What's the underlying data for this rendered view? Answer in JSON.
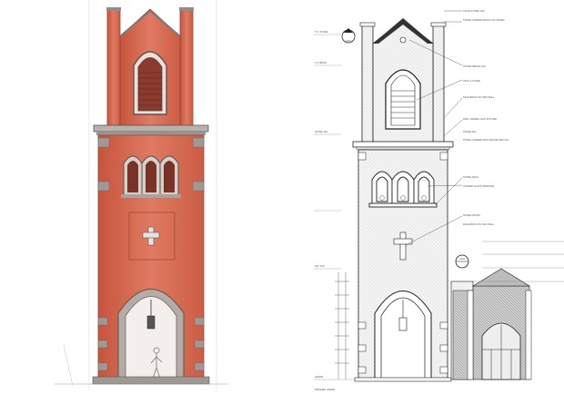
{
  "figure": {
    "left_panel": "watercolor rendering of brick church bell tower (front elevation)",
    "right_panel": "line-drawing architectural elevation with dimension markers and notes"
  },
  "colors": {
    "brick": "#d9705a",
    "brick_dark": "#c2543f",
    "trim": "#6b6b6b",
    "line": "#222222",
    "roof_dark": "#333333",
    "paper": "#ffffff"
  },
  "elevation": {
    "markers": [
      "A301",
      "A202"
    ],
    "notes": [
      "SOLID STONE CAP",
      "STONE CORNER MATCH TO OWNER",
      "STONE MEDALLION",
      "VINYL LOUVER",
      "FACE BRICK ON CMU WALL",
      "WALL GRADE LIGHT FIXTURE",
      "STONE SILL",
      "STONE CORNER WITH PROJECTED SILL",
      "STONE ARCH",
      "STAINED GLASS WINDOWS",
      "STONE CROSS",
      "FACE BRICK ON CMU WALL"
    ],
    "levels": [
      "T.O. STONE",
      "T.O. BRICK",
      "STONE SILL",
      "FIN. FLR.",
      "GRADE"
    ],
    "bottom_label": "FINISHED GRADE"
  }
}
